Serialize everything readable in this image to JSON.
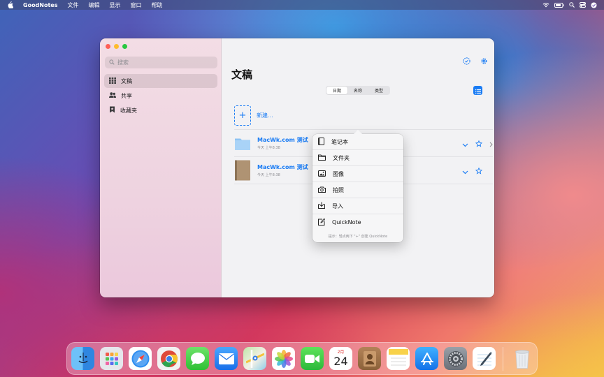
{
  "menubar": {
    "app_name": "GoodNotes",
    "menus": [
      "文件",
      "编辑",
      "显示",
      "窗口",
      "帮助"
    ]
  },
  "sidebar": {
    "search_placeholder": "搜索",
    "items": [
      {
        "label": "文稿",
        "icon": "grid-icon",
        "active": true
      },
      {
        "label": "共享",
        "icon": "people-icon",
        "active": false
      },
      {
        "label": "收藏夹",
        "icon": "bookmark-icon",
        "active": false
      }
    ]
  },
  "main": {
    "title": "文稿",
    "sort_tabs": [
      {
        "label": "日期",
        "active": true
      },
      {
        "label": "名称",
        "active": false
      },
      {
        "label": "类型",
        "active": false
      }
    ],
    "new_label": "新建...",
    "documents": [
      {
        "name": "MacWk.com 测试",
        "date": "今天 上午8:38",
        "kind": "folder"
      },
      {
        "name": "MacWk.com 测试",
        "date": "今天 上午8:38",
        "kind": "notebook"
      }
    ]
  },
  "popover": {
    "items": [
      {
        "label": "笔记本",
        "icon": "notebook-icon"
      },
      {
        "label": "文件夹",
        "icon": "folder-icon"
      },
      {
        "label": "图像",
        "icon": "image-icon"
      },
      {
        "label": "拍照",
        "icon": "camera-icon"
      },
      {
        "label": "导入",
        "icon": "import-icon"
      },
      {
        "label": "QuickNote",
        "icon": "quicknote-icon"
      }
    ],
    "hint": "提示：轻点两下 \"+\" 创建 QuickNote"
  },
  "dock": {
    "calendar_month": "2月",
    "calendar_day": "24",
    "apps": [
      "finder",
      "launchpad",
      "safari",
      "chrome",
      "messages",
      "mail",
      "maps",
      "photos",
      "facetime",
      "calendar",
      "contacts",
      "notes",
      "app-store",
      "system-preferences",
      "goodnotes",
      "trash"
    ]
  },
  "colors": {
    "accent": "#1a7cf4",
    "sidebar_bg": "#f0d6e2",
    "main_bg": "#f2f2f4"
  }
}
